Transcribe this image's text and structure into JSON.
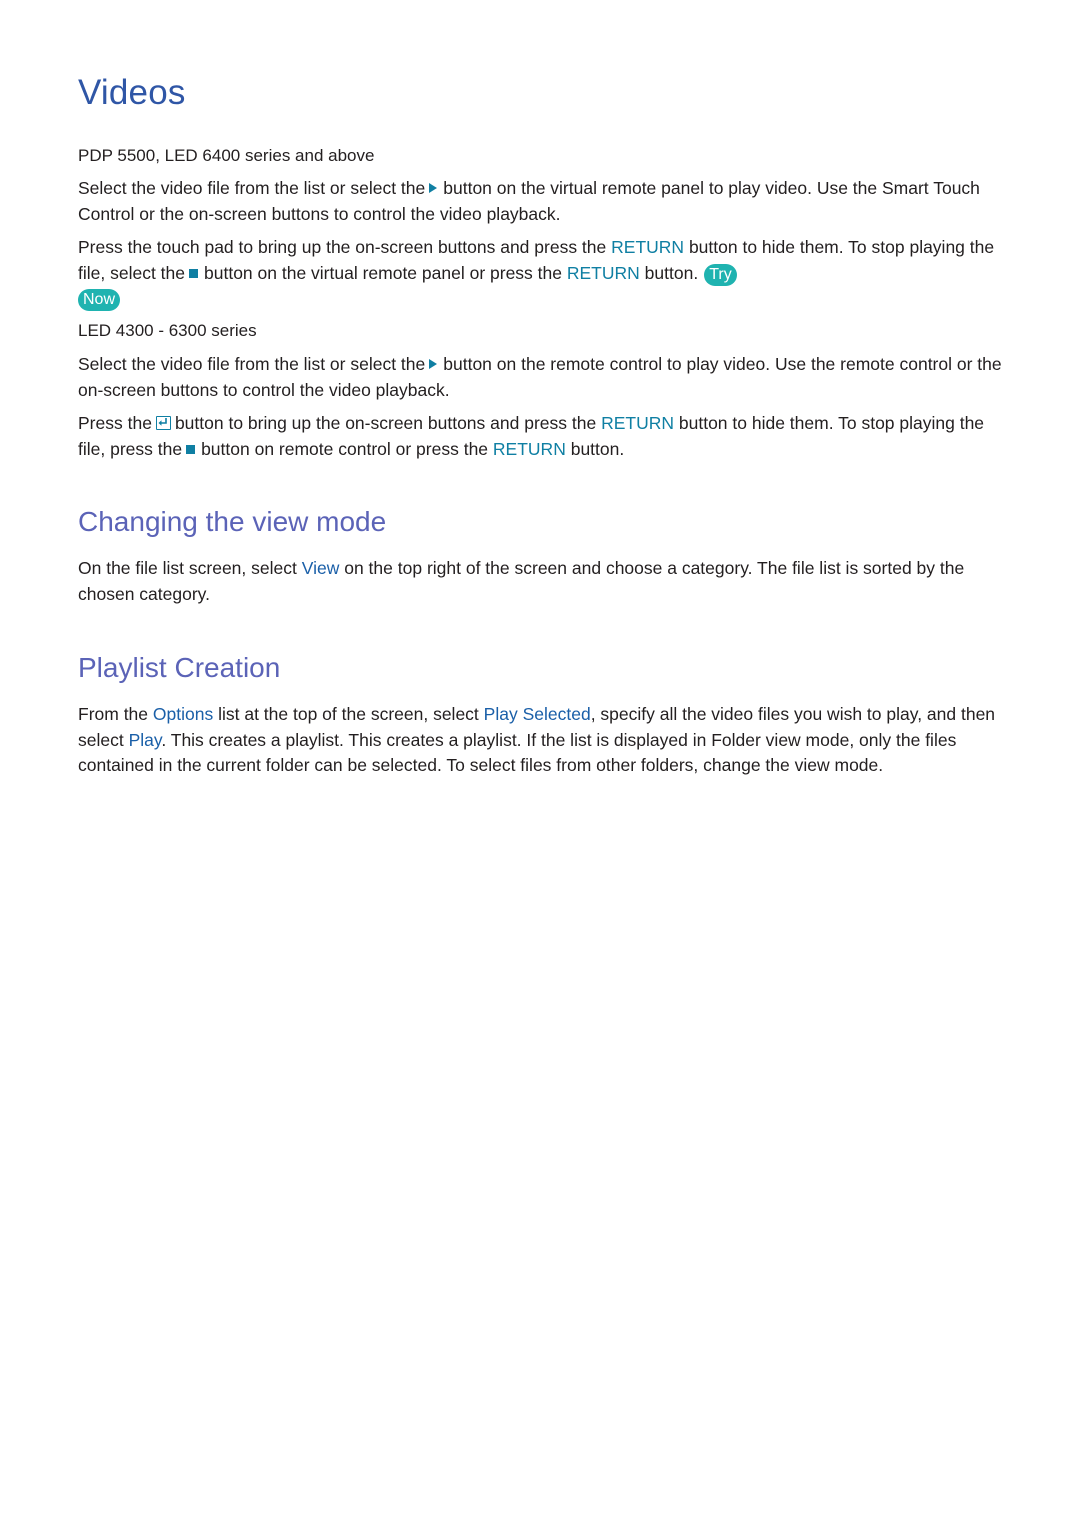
{
  "page": {
    "title": "Videos",
    "colors": {
      "title": "#2f56a6",
      "section_heading": "#5b63b7",
      "keyword_teal": "#0f7fa3",
      "keyword_blue": "#1a5fa8",
      "try_now_badge": "#1fb3b0",
      "body_text": "#231f20"
    }
  },
  "section_pdp": {
    "subhead": "PDP 5500, LED 6400 series and above",
    "p1": {
      "t1": "Select the video file from the list or select the",
      "icon": "play-icon",
      "t2": "button on the virtual remote panel to play video. Use the Smart Touch Control or the on-screen buttons to control the video playback."
    },
    "p2": {
      "t1": "Press the touch pad to bring up the on-screen buttons and press the",
      "kw1": "RETURN",
      "t2": "button to hide them. To stop playing the file, select the",
      "icon": "stop-icon",
      "t3": "button on the virtual remote panel or press the",
      "kw2": "RETURN",
      "t4": "button.",
      "badge_try": "Try",
      "badge_now": "Now"
    }
  },
  "section_led": {
    "subhead": "LED 4300 - 6300 series",
    "p1": {
      "t1": "Select the video file from the list or select the",
      "icon": "play-icon",
      "t2": "button on the remote control to play video. Use the remote control or the on-screen buttons to control the video playback."
    },
    "p2": {
      "t1": "Press the",
      "icon": "enter-icon",
      "t2": "button to bring up the on-screen buttons and press the",
      "kw1": "RETURN",
      "t3": "button to hide them. To stop playing the file, press the",
      "icon2": "stop-icon",
      "t4": "button on remote control or press the",
      "kw2": "RETURN",
      "t5": "button."
    }
  },
  "section_view_mode": {
    "heading": "Changing the view mode",
    "p1": {
      "t1": "On the file list screen, select",
      "kw1": "View",
      "t2": "on the top right of the screen and choose a category. The file list is sorted by the chosen category."
    }
  },
  "section_playlist": {
    "heading": "Playlist Creation",
    "p1": {
      "t1": "From the",
      "kw1": "Options",
      "t2": "list at the top of the screen, select",
      "kw2": "Play Selected",
      "t3": ", specify all the video files you wish to play, and then select",
      "kw3": "Play",
      "t4": ". This creates a playlist. This creates a playlist. If the list is displayed in Folder view mode, only the files contained in the current folder can be selected. To select files from other folders, change the view mode."
    }
  }
}
